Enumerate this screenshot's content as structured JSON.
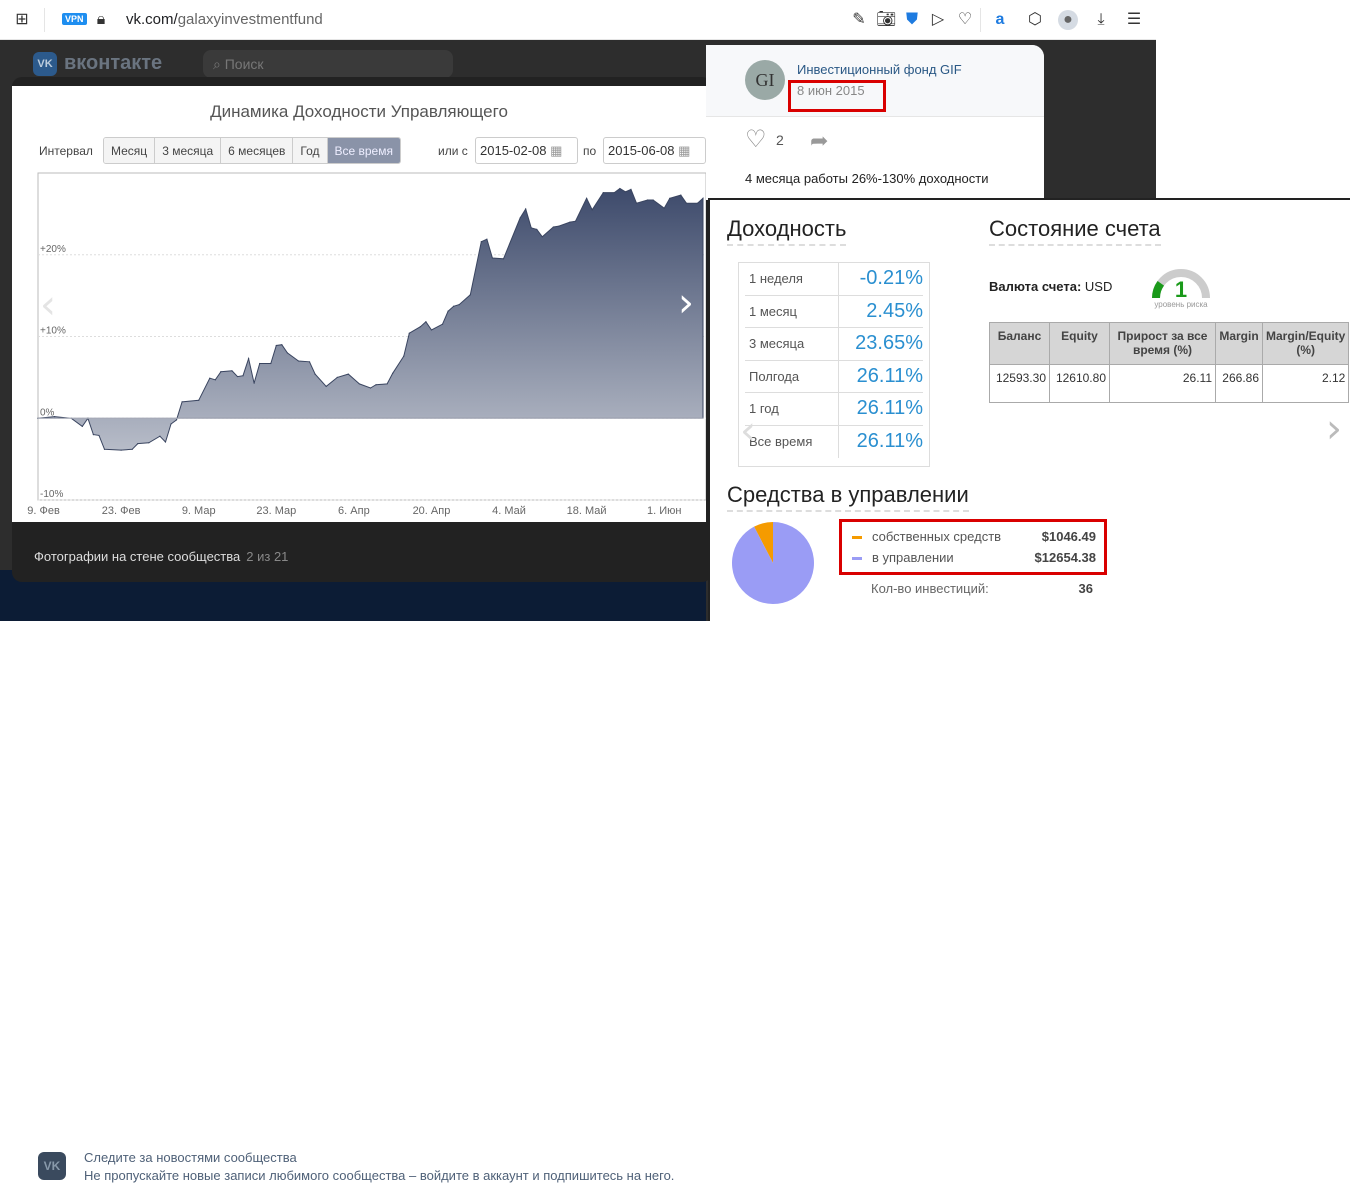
{
  "browser": {
    "url_host": "vk.com/",
    "url_path": "galaxyinvestmentfund",
    "vpn_label": "VPN",
    "icons": [
      "apps-grid-icon",
      "lock-icon",
      "edit-page-icon",
      "camera-icon",
      "shield-check-icon",
      "send-icon",
      "heart-icon",
      "translate-icon",
      "cube-icon",
      "profile-avatar-icon",
      "download-icon",
      "settings-sliders-icon"
    ]
  },
  "vk": {
    "logo_text": "вконтакте",
    "search_placeholder": "Поиск",
    "banner": {
      "title": "Следите за новостями сообщества",
      "text": "Не пропускайте новые записи любимого сообщества – войдите в аккаунт и подпишитесь на него."
    }
  },
  "lightbox": {
    "caption": "Фотографии на стене сообщества",
    "counter": "2 из 21"
  },
  "chart_controls": {
    "interval_label": "Интервал",
    "intervals": [
      "Месяц",
      "3 месяца",
      "6 месяцев",
      "Год",
      "Все время"
    ],
    "active_interval": "Все время",
    "or_from_label": "или с",
    "from_date": "2015-02-08",
    "to_label": "по",
    "to_date": "2015-06-08"
  },
  "chart_data": {
    "type": "area",
    "title": "Динамика Доходности Управляющего",
    "xlabel": "",
    "ylabel": "",
    "xlim": [
      "2015-02-08",
      "2015-06-08"
    ],
    "ylim": [
      -10,
      30
    ],
    "x_ticks": [
      {
        "date": "2015-02-09",
        "label": "9. Фев"
      },
      {
        "date": "2015-02-23",
        "label": "23. Фев"
      },
      {
        "date": "2015-03-09",
        "label": "9. Мар"
      },
      {
        "date": "2015-03-23",
        "label": "23. Мар"
      },
      {
        "date": "2015-04-06",
        "label": "6. Апр"
      },
      {
        "date": "2015-04-20",
        "label": "20. Апр"
      },
      {
        "date": "2015-05-04",
        "label": "4. Май"
      },
      {
        "date": "2015-05-18",
        "label": "18. Май"
      },
      {
        "date": "2015-06-01",
        "label": "1. Июн"
      }
    ],
    "y_ticks": [
      {
        "value": -10,
        "label": "-10%"
      },
      {
        "value": 0,
        "label": "0%"
      },
      {
        "value": 10,
        "label": "+10%"
      },
      {
        "value": 20,
        "label": "+20%"
      }
    ],
    "grid": true,
    "color": "#3d4a6b",
    "series": [
      {
        "points": [
          [
            "2015-02-08",
            0
          ],
          [
            "2015-02-11",
            0.2
          ],
          [
            "2015-02-14",
            0
          ],
          [
            "2015-02-16",
            -1.0
          ],
          [
            "2015-02-17",
            0
          ],
          [
            "2015-02-18",
            -2.0
          ],
          [
            "2015-02-19",
            -2.1
          ],
          [
            "2015-02-20",
            -3.8
          ],
          [
            "2015-02-23",
            -3.9
          ],
          [
            "2015-02-25",
            -3.8
          ],
          [
            "2015-02-26",
            -3.1
          ],
          [
            "2015-02-28",
            -3.0
          ],
          [
            "2015-03-02",
            -2.2
          ],
          [
            "2015-03-03",
            -2.9
          ],
          [
            "2015-03-04",
            -0.7
          ],
          [
            "2015-03-05",
            -0.2
          ],
          [
            "2015-03-06",
            2.0
          ],
          [
            "2015-03-09",
            2.2
          ],
          [
            "2015-03-11",
            4.9
          ],
          [
            "2015-03-12",
            4.7
          ],
          [
            "2015-03-13",
            5.7
          ],
          [
            "2015-03-15",
            5.8
          ],
          [
            "2015-03-16",
            5.1
          ],
          [
            "2015-03-17",
            5.2
          ],
          [
            "2015-03-18",
            7.3
          ],
          [
            "2015-03-19",
            4.3
          ],
          [
            "2015-03-20",
            6.7
          ],
          [
            "2015-03-22",
            6.7
          ],
          [
            "2015-03-23",
            8.9
          ],
          [
            "2015-03-24",
            9.0
          ],
          [
            "2015-03-25",
            8.0
          ],
          [
            "2015-03-27",
            7.0
          ],
          [
            "2015-03-29",
            6.9
          ],
          [
            "2015-03-30",
            5.4
          ],
          [
            "2015-04-01",
            3.9
          ],
          [
            "2015-04-03",
            5.0
          ],
          [
            "2015-04-05",
            5.4
          ],
          [
            "2015-04-07",
            4.2
          ],
          [
            "2015-04-09",
            3.7
          ],
          [
            "2015-04-10",
            4.1
          ],
          [
            "2015-04-12",
            4.2
          ],
          [
            "2015-04-13",
            5.5
          ],
          [
            "2015-04-15",
            7.6
          ],
          [
            "2015-04-16",
            10.4
          ],
          [
            "2015-04-18",
            11.2
          ],
          [
            "2015-04-19",
            11.8
          ],
          [
            "2015-04-20",
            10.8
          ],
          [
            "2015-04-22",
            11.5
          ],
          [
            "2015-04-23",
            13.1
          ],
          [
            "2015-04-24",
            13.7
          ],
          [
            "2015-04-25",
            13.9
          ],
          [
            "2015-04-27",
            15.1
          ],
          [
            "2015-04-29",
            21.6
          ],
          [
            "2015-04-30",
            21.9
          ],
          [
            "2015-05-01",
            19.6
          ],
          [
            "2015-05-03",
            19.5
          ],
          [
            "2015-05-06",
            24.5
          ],
          [
            "2015-05-07",
            25.6
          ],
          [
            "2015-05-08",
            23.3
          ],
          [
            "2015-05-09",
            23.1
          ],
          [
            "2015-05-10",
            22.2
          ],
          [
            "2015-05-12",
            23.4
          ],
          [
            "2015-05-13",
            23.5
          ],
          [
            "2015-05-15",
            24.0
          ],
          [
            "2015-05-16",
            24.1
          ],
          [
            "2015-05-18",
            26.9
          ],
          [
            "2015-05-19",
            25.5
          ],
          [
            "2015-05-21",
            27.6
          ],
          [
            "2015-05-23",
            27.6
          ],
          [
            "2015-05-24",
            28.1
          ],
          [
            "2015-05-25",
            27.7
          ],
          [
            "2015-05-26",
            28.0
          ],
          [
            "2015-05-27",
            26.3
          ],
          [
            "2015-05-29",
            26.7
          ],
          [
            "2015-05-30",
            26.7
          ],
          [
            "2015-06-01",
            25.7
          ],
          [
            "2015-06-02",
            26.9
          ],
          [
            "2015-06-04",
            27.3
          ],
          [
            "2015-06-05",
            26.3
          ],
          [
            "2015-06-07",
            26.3
          ],
          [
            "2015-06-08",
            26.9
          ]
        ]
      }
    ]
  },
  "post": {
    "author": "Инвестиционный фонд GIF",
    "avatar_text": "GI",
    "date": "8 июн 2015",
    "likes": "2",
    "text": "4 месяца работы 26%-130% доходности"
  },
  "stats": {
    "returns_title": "Доходность",
    "returns": [
      {
        "label": "1 неделя",
        "value": "-0.21%"
      },
      {
        "label": "1 месяц",
        "value": "2.45%"
      },
      {
        "label": "3 месяца",
        "value": "23.65%"
      },
      {
        "label": "Полгода",
        "value": "26.11%"
      },
      {
        "label": "1 год",
        "value": "26.11%"
      },
      {
        "label": "Все время",
        "value": "26.11%"
      }
    ],
    "account_title": "Состояние счета",
    "currency_label": "Валюта счета:",
    "currency": "USD",
    "risk_level": "1",
    "risk_label": "уровень риска",
    "risk_fraction": 0.2,
    "account_table": {
      "headers": [
        "Баланс",
        "Equity",
        "Прирост за все время (%)",
        "Margin",
        "Margin/Equity (%)"
      ],
      "row": [
        "12593.30",
        "12610.80",
        "26.11",
        "266.86",
        "2.12"
      ]
    },
    "funds_title": "Средства в управлении",
    "funds": [
      {
        "label": "собственных средств",
        "amount": "$1046.49",
        "value": 1046.49,
        "color": "#f59b00"
      },
      {
        "label": "в управлении",
        "amount": "$12654.38",
        "value": 12654.38,
        "color": "#9a9cf5"
      }
    ],
    "investments_label": "Кол-во инвестиций:",
    "investments": "36"
  }
}
